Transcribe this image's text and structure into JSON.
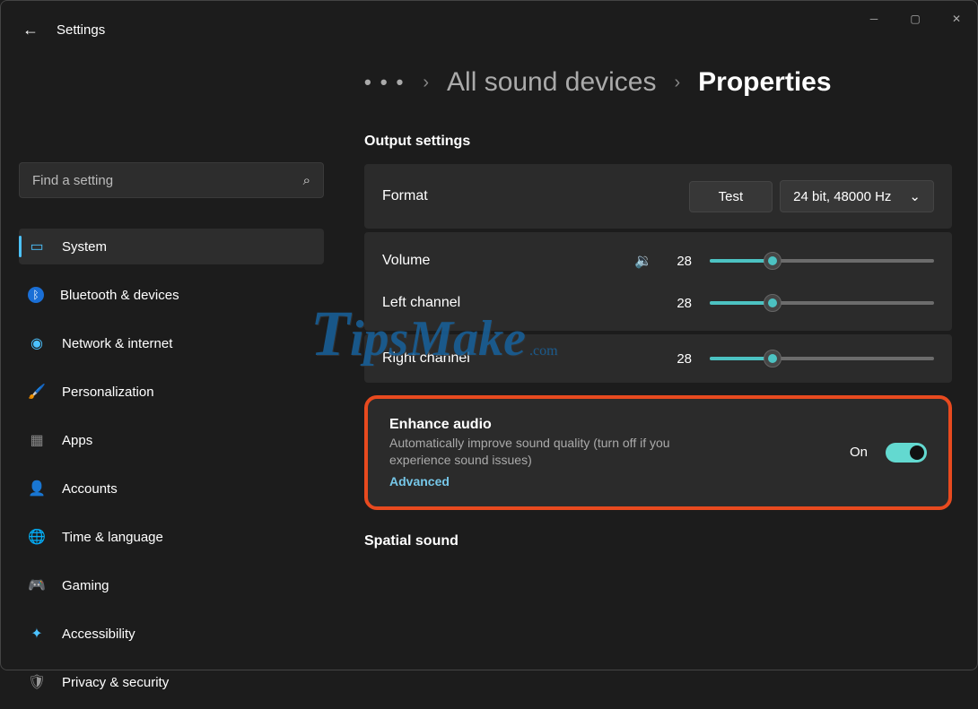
{
  "app_title": "Settings",
  "search": {
    "placeholder": "Find a setting"
  },
  "sidebar": {
    "items": [
      {
        "label": "System",
        "icon": "🖥️",
        "selected": true
      },
      {
        "label": "Bluetooth & devices",
        "icon": "ᛒ"
      },
      {
        "label": "Network & internet",
        "icon": "📶"
      },
      {
        "label": "Personalization",
        "icon": "🖌️"
      },
      {
        "label": "Apps",
        "icon": "▦"
      },
      {
        "label": "Accounts",
        "icon": "👤"
      },
      {
        "label": "Time & language",
        "icon": "🕒"
      },
      {
        "label": "Gaming",
        "icon": "🎮"
      },
      {
        "label": "Accessibility",
        "icon": "♿"
      },
      {
        "label": "Privacy & security",
        "icon": "🛡️"
      }
    ]
  },
  "breadcrumb": {
    "more": "• • •",
    "mid": "All sound devices",
    "current": "Properties"
  },
  "section_output": "Output settings",
  "format": {
    "label": "Format",
    "test_btn": "Test",
    "dropdown": "24 bit, 48000 Hz"
  },
  "volume": {
    "label": "Volume",
    "value": "28",
    "percent": 28
  },
  "left": {
    "label": "Left channel",
    "value": "28",
    "percent": 28
  },
  "right": {
    "label": "Right channel",
    "value": "28",
    "percent": 28
  },
  "enhance": {
    "title": "Enhance audio",
    "desc": "Automatically improve sound quality (turn off if you experience sound issues)",
    "link": "Advanced",
    "state": "On"
  },
  "section_spatial": "Spatial sound",
  "watermark": {
    "text": "TipsMake",
    "suffix": ".com"
  }
}
